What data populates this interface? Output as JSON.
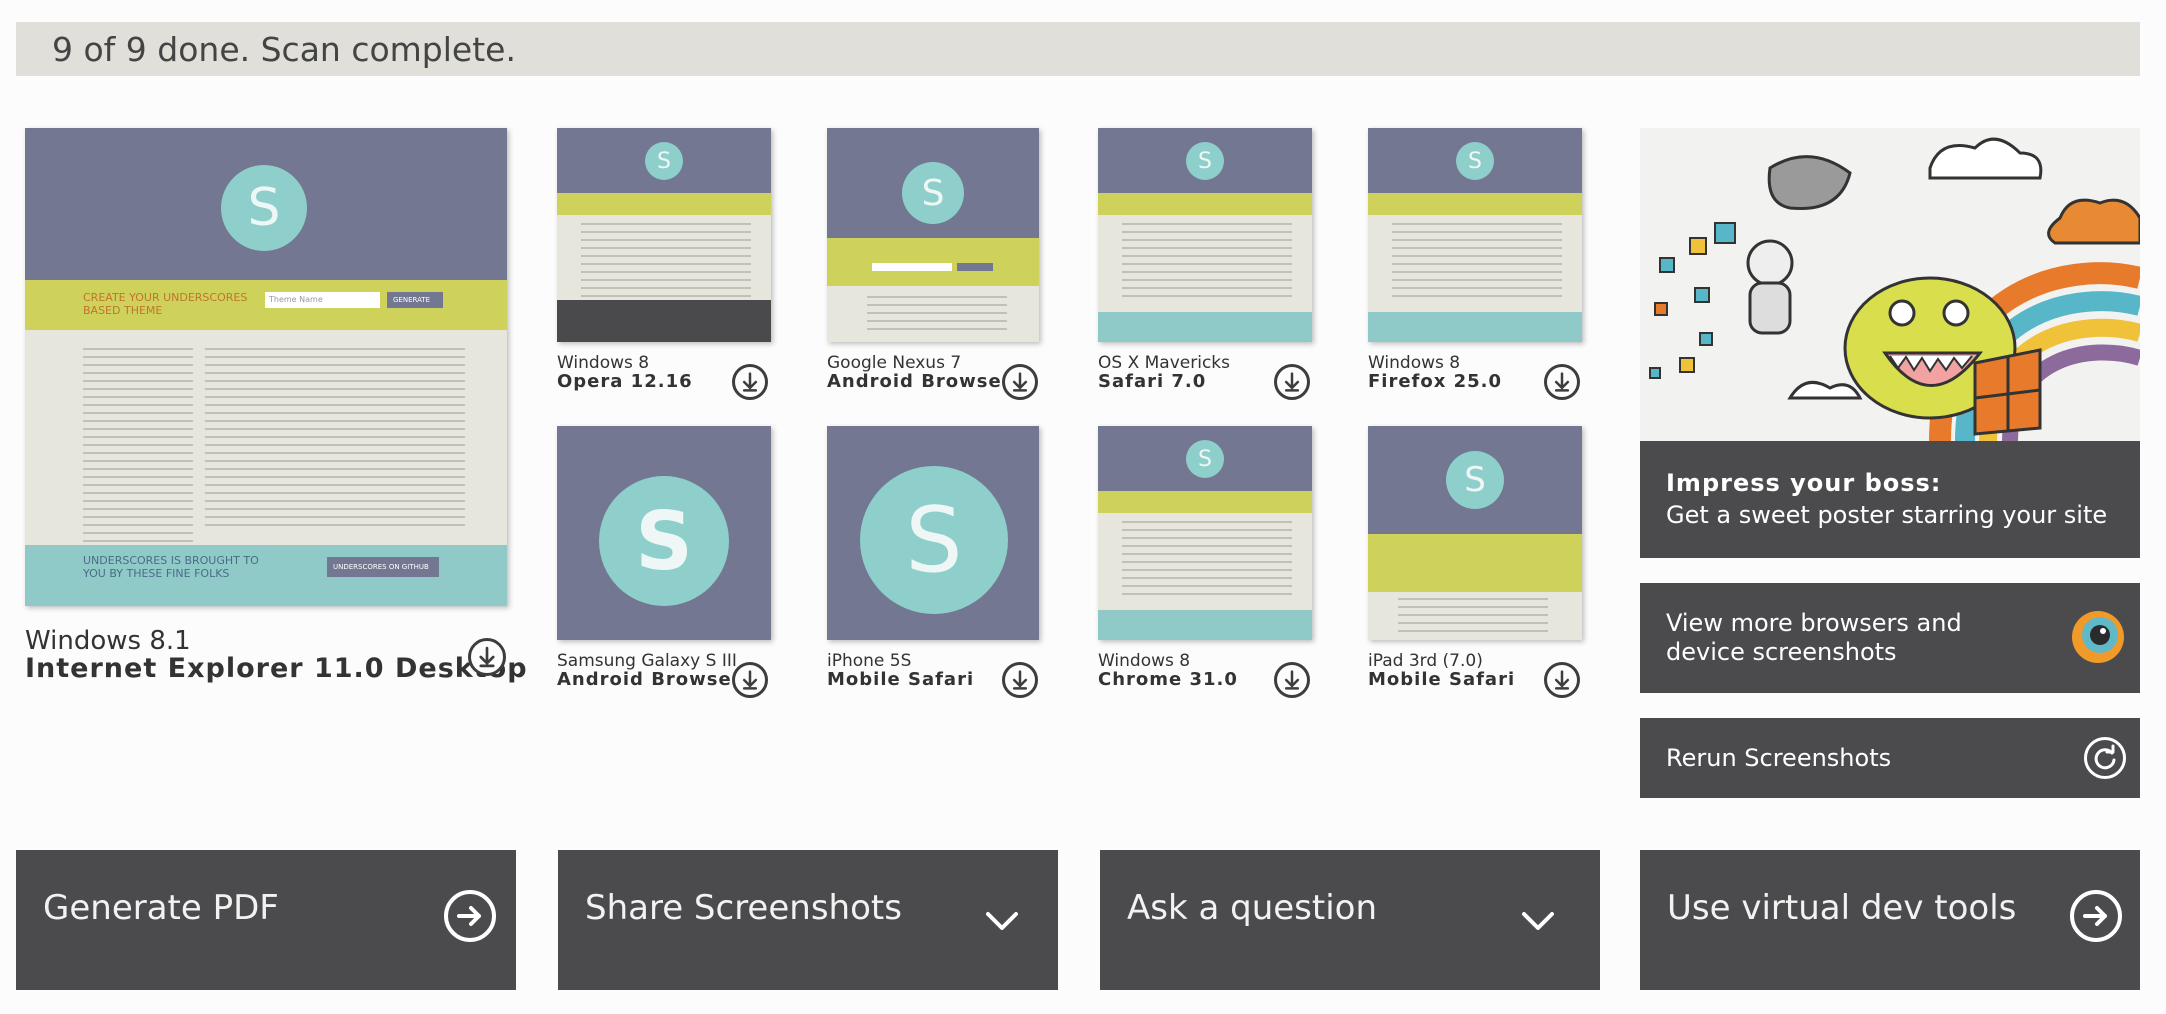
{
  "status": "9 of 9 done. Scan complete.",
  "screenshots": [
    {
      "os": "Windows 8.1",
      "browser": "Internet Explorer 11.0 Desktop"
    },
    {
      "os": "Windows 8",
      "browser": "Opera 12.16"
    },
    {
      "os": "Google Nexus 7",
      "browser": "Android Browser"
    },
    {
      "os": "OS X Mavericks",
      "browser": "Safari 7.0"
    },
    {
      "os": "Windows 8",
      "browser": "Firefox 25.0"
    },
    {
      "os": "Samsung Galaxy S III",
      "browser": "Android Browser"
    },
    {
      "os": "iPhone 5S",
      "browser": "Mobile Safari"
    },
    {
      "os": "Windows 8",
      "browser": "Chrome 31.0"
    },
    {
      "os": "iPad 3rd (7.0)",
      "browser": "Mobile Safari"
    }
  ],
  "mock_site": {
    "logo_letter": "S",
    "headline": "CREATE YOUR UNDERSCORES BASED THEME",
    "input_placeholder": "Theme Name",
    "generate_label": "GENERATE",
    "footer_headline": "UNDERSCORES IS BROUGHT TO YOU BY THESE FINE FOLKS",
    "footer_button": "UNDERSCORES ON GITHUB"
  },
  "promo": {
    "title": "Impress your boss:",
    "subtitle": "Get a sweet poster starring your site"
  },
  "side_actions": {
    "more_browsers": "View more browsers and device screenshots",
    "rerun": "Rerun Screenshots"
  },
  "bottom_actions": {
    "pdf": "Generate PDF",
    "share": "Share Screenshots",
    "ask": "Ask a question",
    "devtools": "Use virtual dev tools"
  },
  "colors": {
    "tile_bg": "#4b4b4d",
    "status_bg": "#e0dfd9",
    "thumb_header": "#737791",
    "thumb_accent": "#cfd25a",
    "thumb_teal": "#8fcfcb"
  },
  "icons": {
    "download": "download-icon",
    "arrow": "arrow-right-icon",
    "chevron": "chevron-down-icon",
    "rerun": "refresh-icon",
    "browsers": "eye-icon"
  }
}
